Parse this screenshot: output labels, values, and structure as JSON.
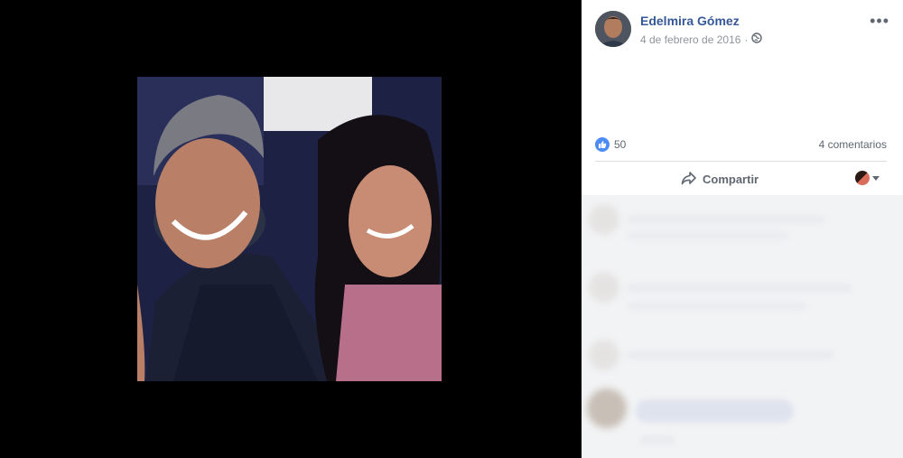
{
  "post": {
    "author_name": "Edelmira Gómez",
    "date": "4 de febrero de 2016",
    "separator": "·",
    "privacy_icon": "globe-icon",
    "more_icon": "ellipsis-icon",
    "more_label": "•••"
  },
  "stats": {
    "like_icon": "thumbs-up-icon",
    "like_count": "50",
    "comments_count": "4 comentarios"
  },
  "actions": {
    "share_label": "Compartir",
    "share_icon": "share-arrow-icon",
    "audience_icon": "profile-selector-icon"
  },
  "colors": {
    "author_link": "#365899",
    "like_badge": "#4e8cf5",
    "photo_backdrop": "#000000",
    "panel_background": "#ffffff"
  }
}
